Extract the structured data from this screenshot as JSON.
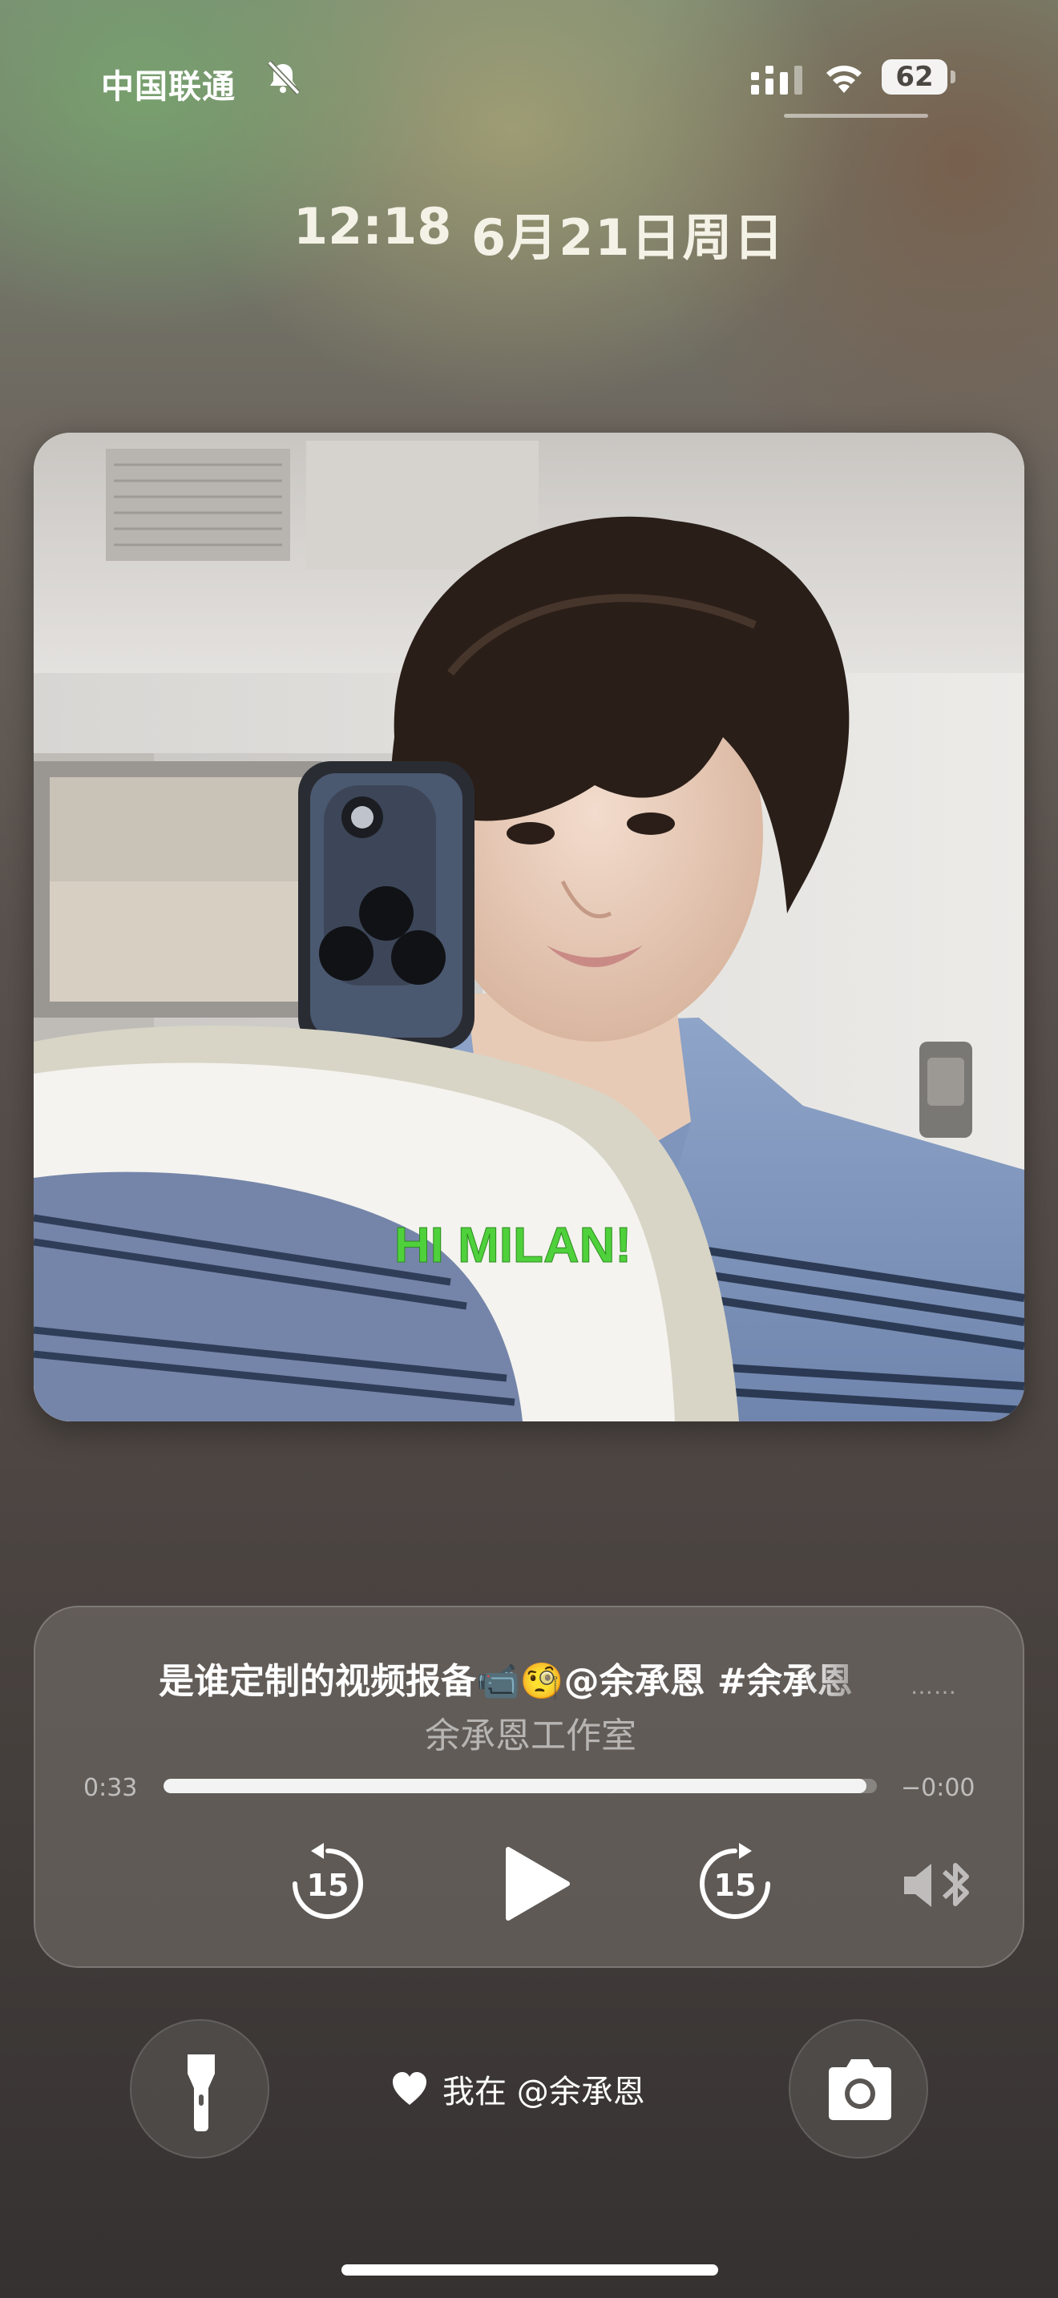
{
  "status_bar": {
    "carrier": "中国联通",
    "mute_icon": "bell-slash-icon",
    "signal_icon": "cellular-signal-icon",
    "wifi_icon": "wifi-icon",
    "battery_percent": "62"
  },
  "lock_screen": {
    "time": "12:18",
    "date": "6月21日周日"
  },
  "artwork": {
    "overlay_text": "HI MILAN!",
    "overlay_color": "#4fd13c"
  },
  "now_playing": {
    "title": "是谁定制的视频报备📹🧐@余承恩  #余承恩",
    "more_indicator": "……",
    "artist": "余承恩工作室",
    "elapsed": "0:33",
    "remaining": "−0:00",
    "progress_fraction": 0.985,
    "skip_back_seconds": "15",
    "skip_forward_seconds": "15",
    "play_icon": "play-icon",
    "output_icon": "speaker-bluetooth-icon"
  },
  "bottom_bar": {
    "flashlight_icon": "flashlight-icon",
    "camera_icon": "camera-icon",
    "like_icon": "heart-icon",
    "like_text": "我在 @余承恩"
  }
}
